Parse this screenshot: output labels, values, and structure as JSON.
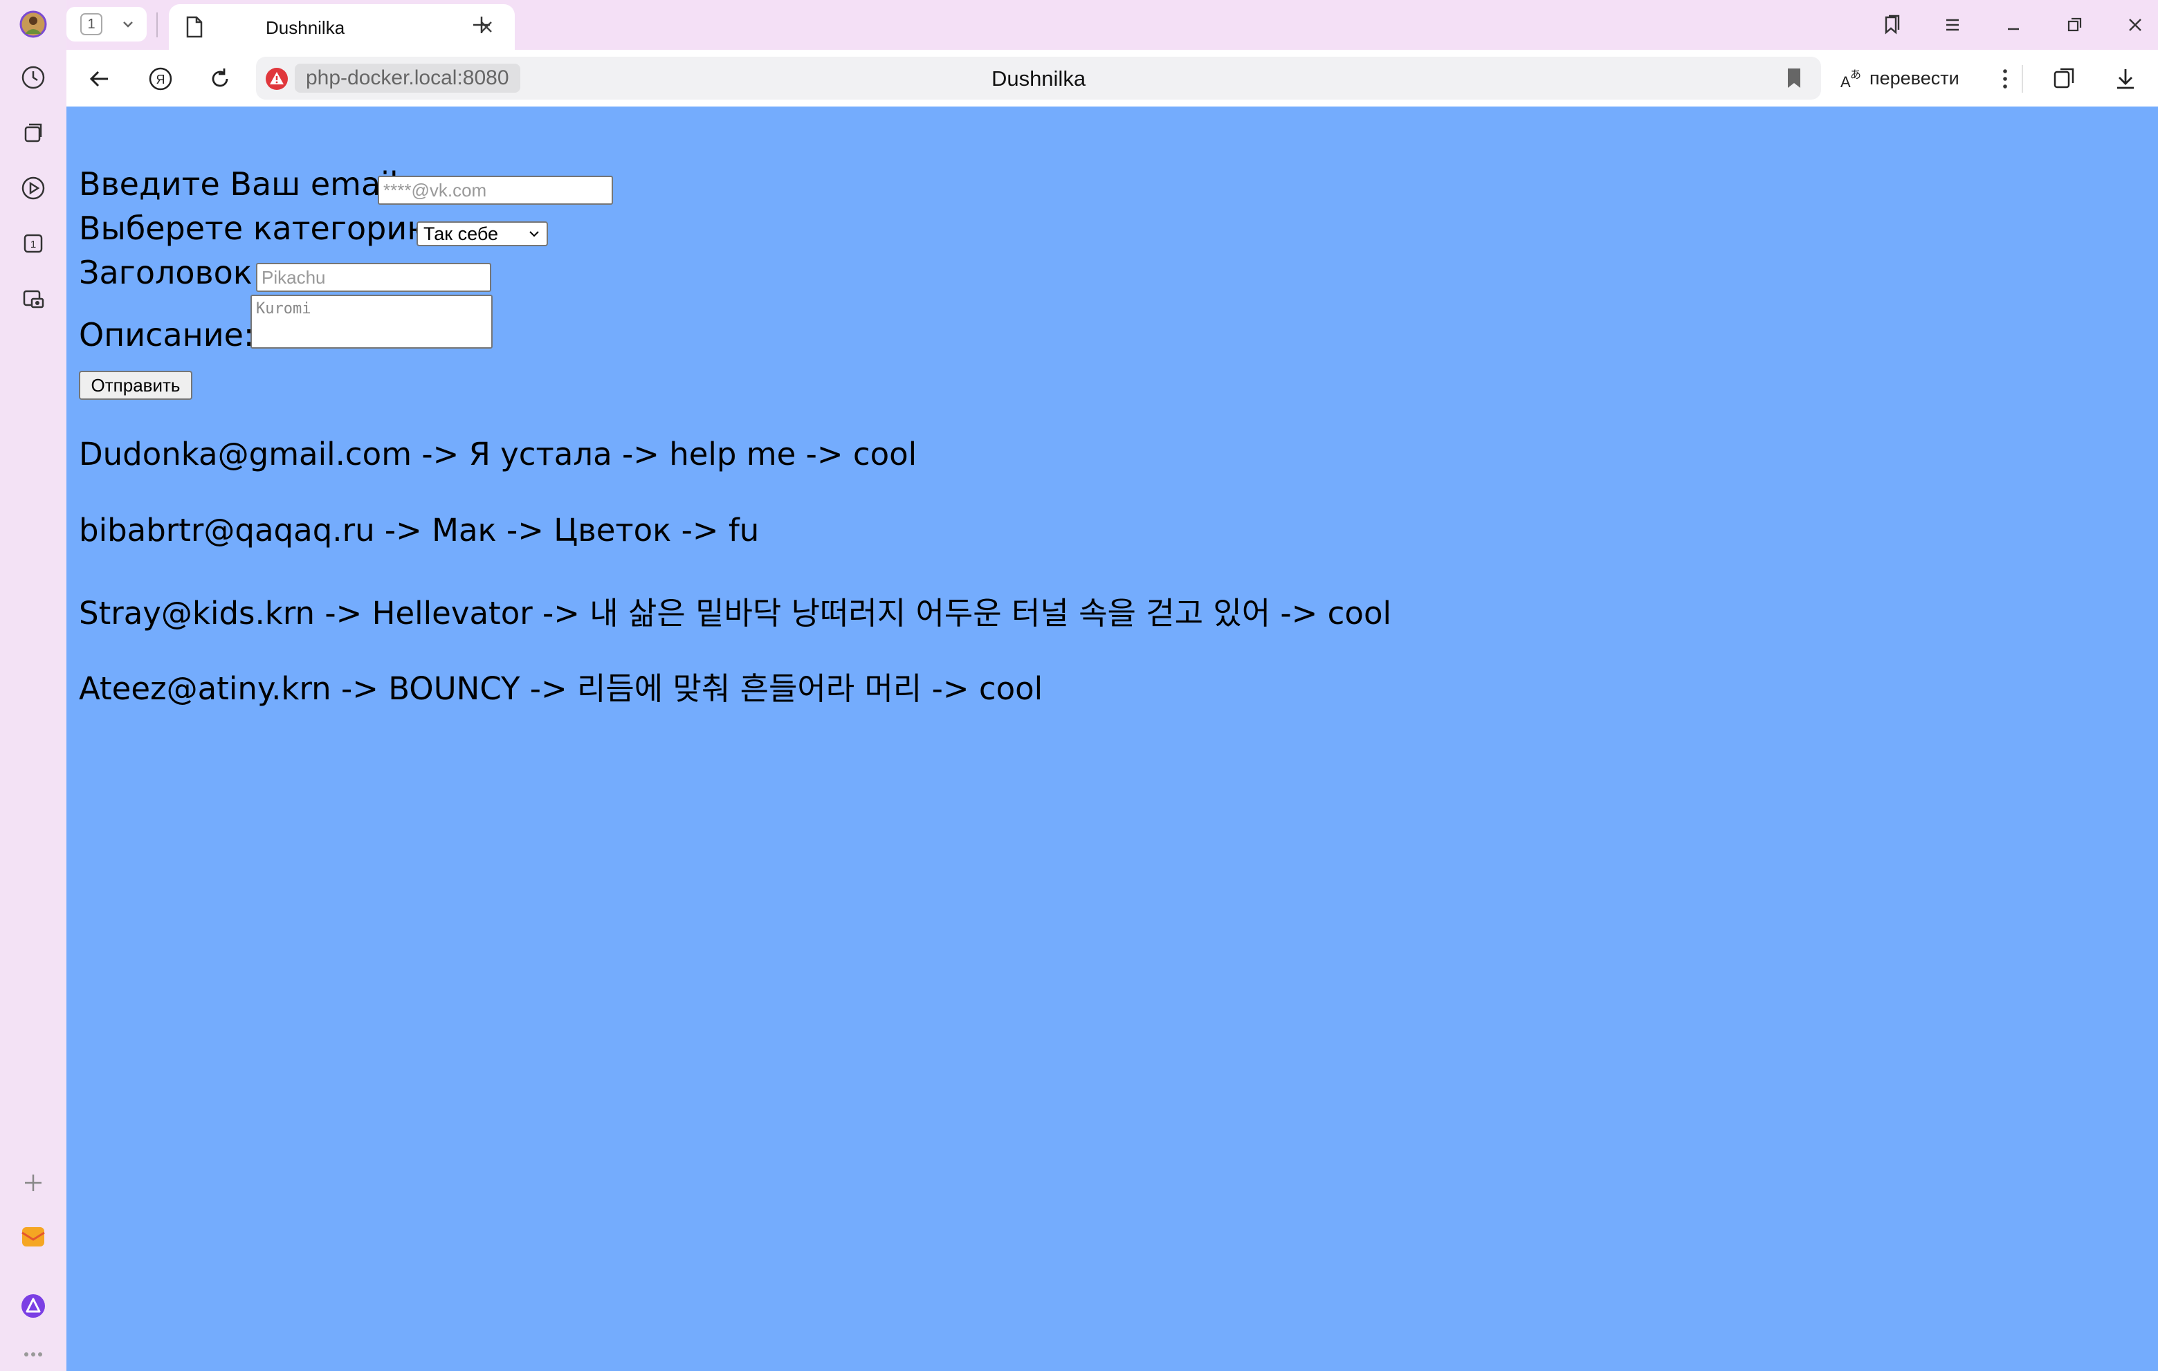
{
  "browser": {
    "tab_count": "1",
    "tab_title": "Dushnilka",
    "url": "php-docker.local:8080",
    "page_title": "Dushnilka",
    "translate_label": "перевести"
  },
  "form": {
    "email_label": "Введите Ваш email:",
    "email_placeholder": "****@vk.com",
    "category_label": "Выберете категорию:",
    "category_selected": "Так себе",
    "title_label": "Заголовок:",
    "title_placeholder": "Pikachu",
    "description_label": "Описание:",
    "description_placeholder": "Kuromi",
    "submit_label": "Отправить"
  },
  "entries": [
    "Dudonka@gmail.com -> Я устала -> help me -> cool",
    "bibabrtr@qaqaq.ru -> Мак -> Цветок -> fu",
    "Stray@kids.krn -> Hellevator -> 내 삶은 밑바닥 낭떠러지 어두운 터널 속을 걷고 있어 -> cool",
    "Ateez@atiny.krn -> BOUNCY -> 리듬에 맞춰 흔들어라 머리 -> cool"
  ],
  "colors": {
    "page_background": "#74acfd",
    "browser_chrome": "#f4e0f6"
  }
}
